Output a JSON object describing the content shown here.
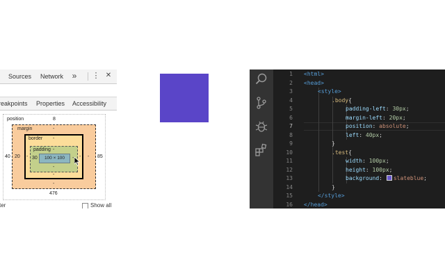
{
  "devtools": {
    "tabs": [
      "Sources",
      "Network"
    ],
    "more_tabs_icon": "double-chevron-right-icon",
    "more_glyph": "»",
    "menu_glyph": "⋮",
    "close_glyph": "✕",
    "subtabs": [
      "reakpoints",
      "Properties",
      "Accessibility"
    ],
    "box_model": {
      "position_label": "position",
      "position_top": "8",
      "position_left": "40",
      "position_right": "85",
      "position_bottom": "476",
      "margin_label": "margin",
      "margin_top": "-",
      "margin_left": "20",
      "margin_right": "-",
      "margin_bottom": "-",
      "border_label": "border",
      "border_top": "-",
      "border_left": "-",
      "border_right": "-",
      "border_bottom": "-",
      "padding_label": "padding",
      "padding_top": "-",
      "padding_left": "30",
      "padding_right": "-",
      "padding_bottom": "-",
      "content_size": "100 × 100",
      "colors": {
        "margin": "#f9cc9d",
        "border": "#fcdd9a",
        "padding": "#c3d08b",
        "content": "#8cb6c0"
      }
    },
    "filter_partial": "ter",
    "show_all_label": "Show all"
  },
  "viewport": {
    "box_color": "#5a45c8"
  },
  "editor": {
    "line_numbers": [
      "1",
      "2",
      "3",
      "4",
      "5",
      "6",
      "7",
      "8",
      "9",
      "10",
      "11",
      "12",
      "13",
      "14",
      "15",
      "16"
    ],
    "active_line": 7,
    "lines": [
      [
        {
          "t": "<html>",
          "c": "tag"
        }
      ],
      [
        {
          "t": "<head>",
          "c": "tag"
        }
      ],
      [
        {
          "t": "<style>",
          "c": "tag"
        }
      ],
      [
        {
          "t": ".body",
          "c": "sel"
        },
        {
          "t": "{",
          "c": "pun"
        }
      ],
      [
        {
          "t": "padding-left",
          "c": "prop"
        },
        {
          "t": ": ",
          "c": "pun"
        },
        {
          "t": "30px",
          "c": "num"
        },
        {
          "t": ";",
          "c": "pun"
        }
      ],
      [
        {
          "t": "margin-left",
          "c": "prop"
        },
        {
          "t": ": ",
          "c": "pun"
        },
        {
          "t": "20px",
          "c": "num"
        },
        {
          "t": ";",
          "c": "pun"
        }
      ],
      [
        {
          "t": "position",
          "c": "prop"
        },
        {
          "t": ": ",
          "c": "pun"
        },
        {
          "t": "absolute",
          "c": "val"
        },
        {
          "t": ";",
          "c": "pun"
        }
      ],
      [
        {
          "t": "left",
          "c": "prop"
        },
        {
          "t": ": ",
          "c": "pun"
        },
        {
          "t": "40px",
          "c": "num"
        },
        {
          "t": ";",
          "c": "pun"
        }
      ],
      [
        {
          "t": "}",
          "c": "pun"
        }
      ],
      [
        {
          "t": ".test",
          "c": "sel"
        },
        {
          "t": "{",
          "c": "pun"
        }
      ],
      [
        {
          "t": "width",
          "c": "prop"
        },
        {
          "t": ": ",
          "c": "pun"
        },
        {
          "t": "100px",
          "c": "num"
        },
        {
          "t": ";",
          "c": "pun"
        }
      ],
      [
        {
          "t": "height",
          "c": "prop"
        },
        {
          "t": ": ",
          "c": "pun"
        },
        {
          "t": "100px",
          "c": "num"
        },
        {
          "t": ";",
          "c": "pun"
        }
      ],
      [
        {
          "t": "background",
          "c": "prop"
        },
        {
          "t": ": ",
          "c": "pun"
        },
        {
          "t": "SWATCH",
          "c": "swatch"
        },
        {
          "t": "slateblue",
          "c": "val"
        },
        {
          "t": ";",
          "c": "pun"
        }
      ],
      [
        {
          "t": "}",
          "c": "pun"
        }
      ],
      [
        {
          "t": "</style>",
          "c": "tag"
        }
      ],
      [
        {
          "t": "</head>",
          "c": "tag"
        }
      ]
    ],
    "swatch_color": "#6a5acd",
    "activity_icons": [
      "search-icon",
      "source-control-icon",
      "debug-icon",
      "extensions-icon"
    ]
  }
}
